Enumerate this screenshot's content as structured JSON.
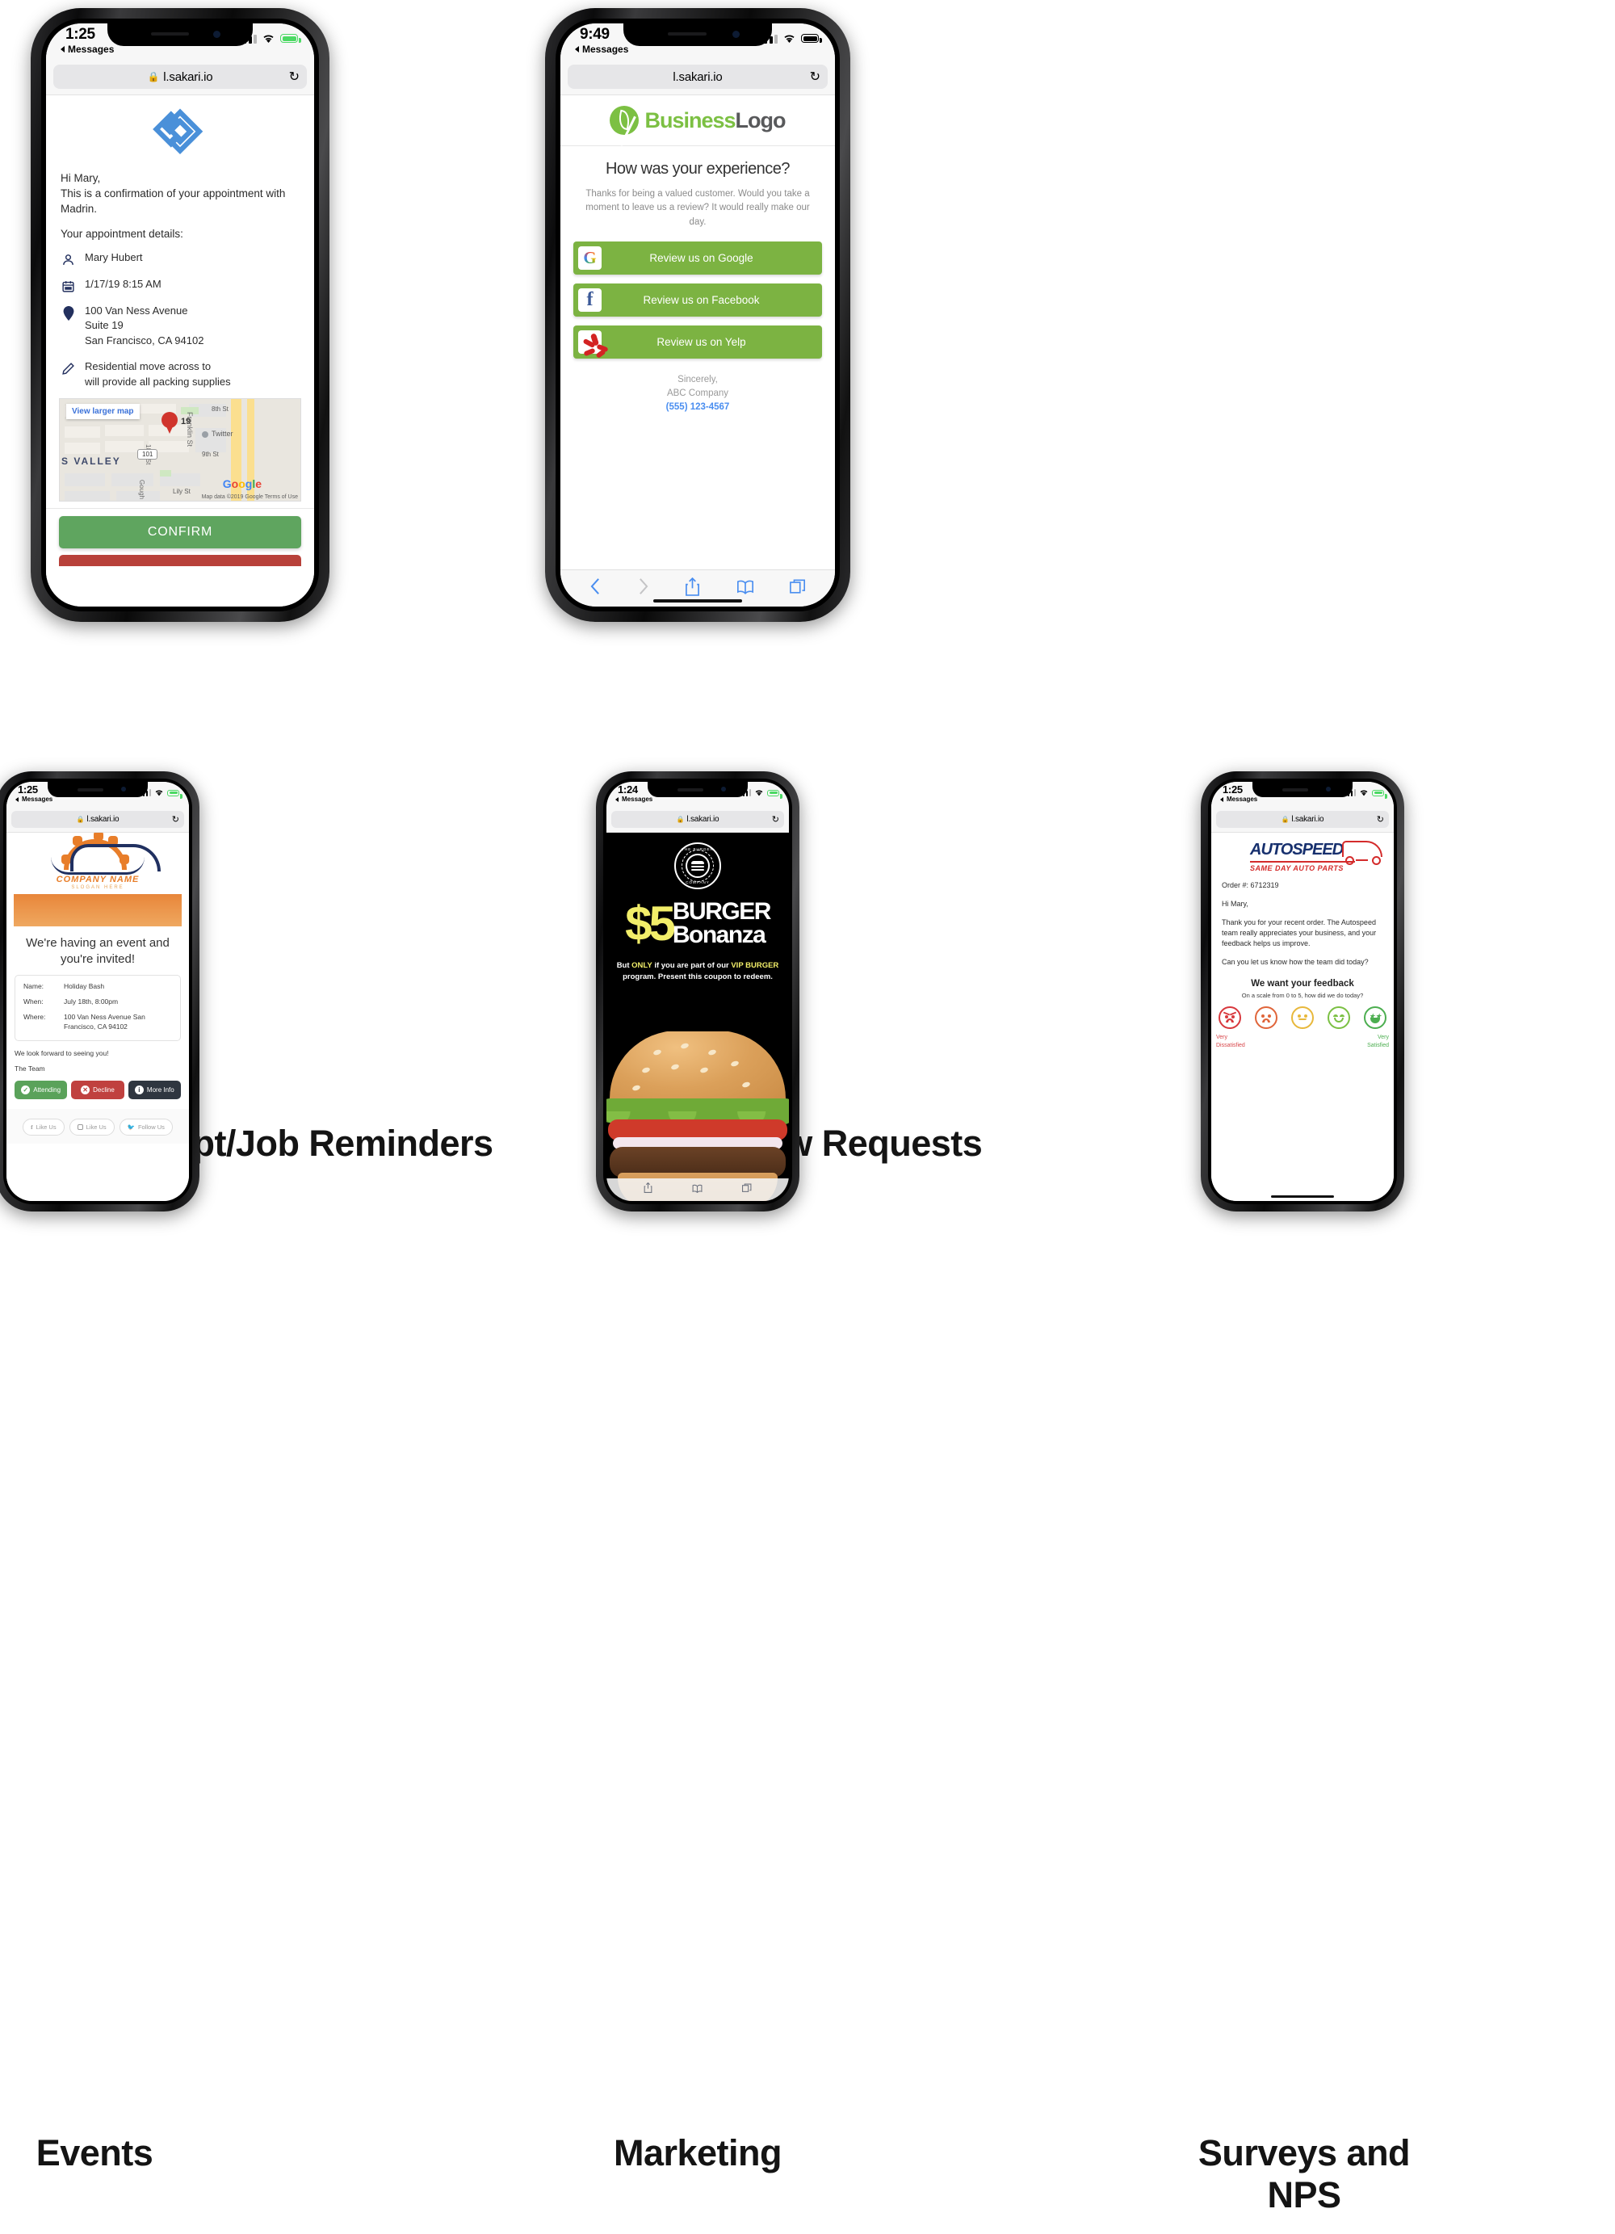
{
  "captions": {
    "appt": "Appt/Job Reminders",
    "review": "Review Requests",
    "events": "Events",
    "marketing": "Marketing",
    "surveys": "Surveys and NPS"
  },
  "phone_appt": {
    "status": {
      "time": "1:25",
      "back": "Messages"
    },
    "browser": {
      "url": "l.sakari.io",
      "lock": "lock-icon",
      "reload": "↻"
    },
    "greeting": "Hi Mary,",
    "intro": "This is a confirmation of your appointment with Madrin.",
    "details_label": "Your appointment details:",
    "details": [
      {
        "icon": "person-icon",
        "lines": [
          "Mary Hubert"
        ]
      },
      {
        "icon": "calendar-icon",
        "lines": [
          "1/17/19   8:15 AM"
        ]
      },
      {
        "icon": "location-pin-icon",
        "lines": [
          "100 Van Ness Avenue",
          "Suite 19",
          "San Francisco, CA 94102"
        ]
      },
      {
        "icon": "pencil-icon",
        "lines": [
          "Residential move across to",
          "will provide all packing supplies"
        ]
      }
    ],
    "map": {
      "view_larger": "View larger map",
      "pin_number": "19",
      "poi": "Twitter",
      "street_franklin": "Franklin St",
      "street_8th": "8th St",
      "street_9th": "9th St",
      "street_10th": "10th St",
      "street_gough": "Gough",
      "street_lily": "Lily St",
      "neighborhood": "ES VALLEY",
      "highway": "101",
      "brand": "Google",
      "credit": "Map data ©2019 Google   Terms of Use"
    },
    "confirm_label": "CONFIRM"
  },
  "phone_review": {
    "status": {
      "time": "9:49",
      "back": "Messages"
    },
    "browser": {
      "url": "l.sakari.io",
      "reload": "↻"
    },
    "logo": {
      "mark": "leaf-icon",
      "part1": "Business",
      "part2": "Logo"
    },
    "heading": "How was your experience?",
    "subtext": "Thanks for being a valued customer. Would you take a moment to leave us a review? It would really make our day.",
    "buttons": [
      {
        "icon": "google-icon",
        "label": "Review us on Google"
      },
      {
        "icon": "facebook-icon",
        "label": "Review us on Facebook"
      },
      {
        "icon": "yelp-icon",
        "label": "Review us on Yelp"
      }
    ],
    "signoff": "Sincerely,",
    "company": "ABC Company",
    "phone": "(555) 123-4567",
    "toolbar": [
      "back-icon",
      "forward-icon",
      "share-icon",
      "bookmarks-icon",
      "tabs-icon"
    ]
  },
  "phone_events": {
    "status": {
      "time": "1:25",
      "back": "Messages"
    },
    "browser": {
      "url": "l.sakari.io",
      "reload": "↻"
    },
    "logo": {
      "name": "COMPANY NAME",
      "slogan": "SLOGAN HERE"
    },
    "heading": "We're having an event and you're invited!",
    "fields": [
      {
        "key": "Name:",
        "value": "Holiday Bash"
      },
      {
        "key": "When:",
        "value": "July 18th, 8:00pm"
      },
      {
        "key": "Where:",
        "value": "100 Van Ness Avenue San Francisco, CA 94102"
      }
    ],
    "closing1": "We look forward to seeing you!",
    "closing2": "The Team",
    "actions": [
      {
        "icon": "check-circle-icon",
        "label": "Attending"
      },
      {
        "icon": "x-circle-icon",
        "label": "Decline"
      },
      {
        "icon": "info-circle-icon",
        "label": "More Info"
      }
    ],
    "social": [
      {
        "icon": "facebook-icon",
        "label": "Like Us"
      },
      {
        "icon": "instagram-icon",
        "label": "Like Us"
      },
      {
        "icon": "twitter-icon",
        "label": "Follow Us"
      }
    ]
  },
  "phone_marketing": {
    "status": {
      "time": "1:24",
      "back": "Messages"
    },
    "browser": {
      "url": "l.sakari.io",
      "reload": "↻"
    },
    "stamp": {
      "top": "THE BURGER",
      "bottom": "COMPANY"
    },
    "price": "$5",
    "line1": "BURGER",
    "line2": "Bonanza",
    "fine_a": "But ",
    "fine_b": "ONLY",
    "fine_c": " if you are part of our ",
    "fine_d": "VIP BURGER",
    "fine_e": " program. Present this coupon to redeem.",
    "toolbar": [
      "share-icon",
      "bookmarks-icon",
      "tabs-icon"
    ]
  },
  "phone_survey": {
    "status": {
      "time": "1:25",
      "back": "Messages"
    },
    "browser": {
      "url": "l.sakari.io",
      "reload": "↻"
    },
    "logo": {
      "name": "AUTOSPEED",
      "tagline": "SAME DAY AUTO PARTS"
    },
    "order": "Order #: 6712319",
    "greeting": "Hi Mary,",
    "para1": "Thank you for your recent order. The Autospeed team really appreciates your business, and your feedback helps us improve.",
    "para2": "Can you let us know how the team did today?",
    "feedback_title": "We want your feedback",
    "scale_prompt": "On a scale from 0 to 5, how did we do today?",
    "faces": [
      "angry-face-icon",
      "sad-face-icon",
      "neutral-face-icon",
      "happy-face-icon",
      "star-eyes-face-icon"
    ],
    "legend_low1": "Very",
    "legend_low2": "Dissatisfied",
    "legend_high1": "Very",
    "legend_high2": "Satisfied"
  },
  "colors": {
    "green_confirm": "#5fa55f",
    "green_review": "#7cb342",
    "orange": "#e8863a",
    "navy": "#17306e",
    "red": "#d42b2b",
    "yellow": "#f2ee69"
  }
}
